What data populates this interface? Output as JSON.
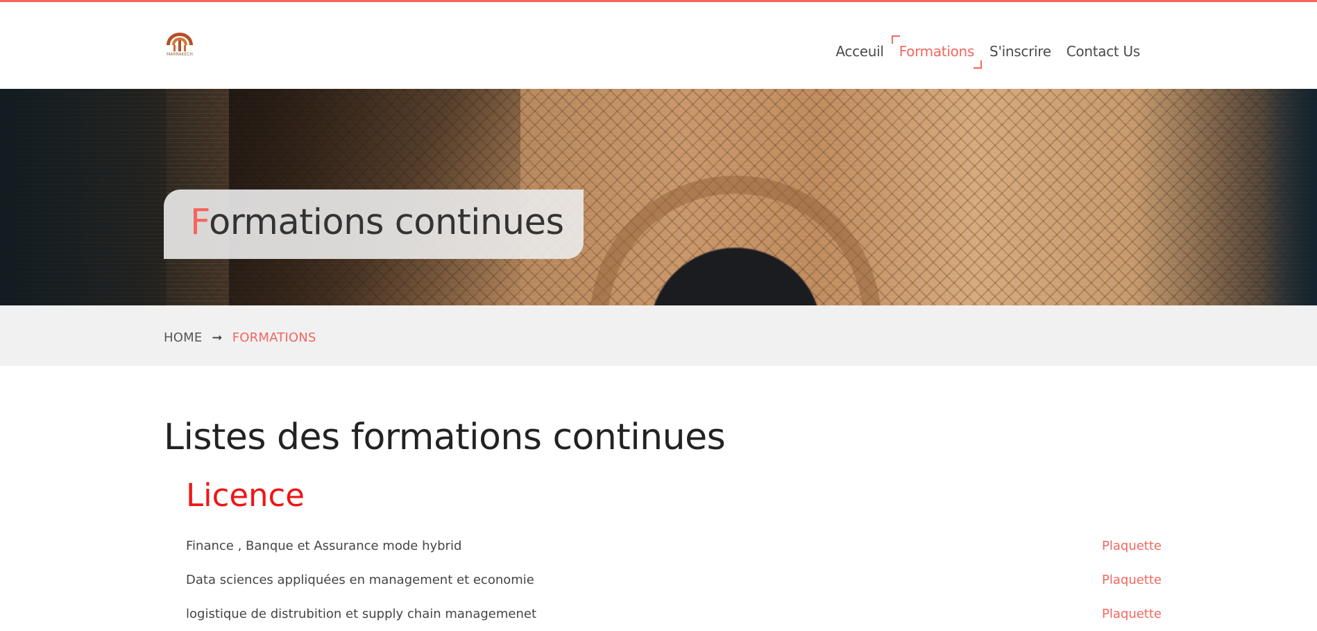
{
  "colors": {
    "accent": "#f2665e",
    "section_heading": "#f01414",
    "breadcrumb_bar": "#f1f1f1"
  },
  "header": {
    "logo_icon": "university-logo-icon",
    "logo_text": "MARRAKECH",
    "nav": [
      {
        "label": "Acceuil",
        "active": false
      },
      {
        "label": "Formations",
        "active": true
      },
      {
        "label": "S'inscrire",
        "active": false
      },
      {
        "label": "Contact Us",
        "active": false
      }
    ]
  },
  "hero": {
    "title_first_letter": "F",
    "title_rest": "ormations continues"
  },
  "breadcrumb": {
    "home": "HOME",
    "separator_icon": "arrow-right-icon",
    "separator": "➞",
    "current": "FORMATIONS"
  },
  "main": {
    "title": "Listes des formations continues",
    "sections": [
      {
        "title": "Licence",
        "courses": [
          {
            "name": "Finance , Banque et Assurance mode hybrid",
            "link": "Plaquette"
          },
          {
            "name": "Data sciences appliquées en management et economie",
            "link": "Plaquette"
          },
          {
            "name": "logistique de distrubition et supply chain managemenet",
            "link": "Plaquette"
          }
        ]
      }
    ]
  }
}
